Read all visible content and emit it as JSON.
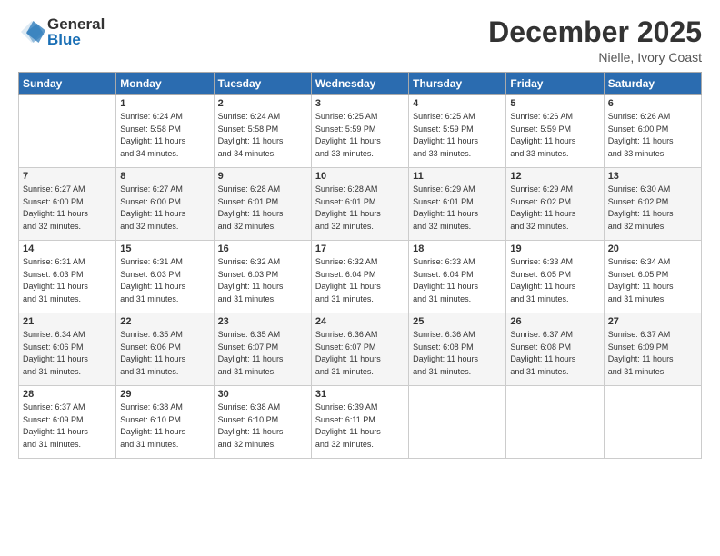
{
  "logo": {
    "general": "General",
    "blue": "Blue"
  },
  "title": "December 2025",
  "location": "Nielle, Ivory Coast",
  "headers": [
    "Sunday",
    "Monday",
    "Tuesday",
    "Wednesday",
    "Thursday",
    "Friday",
    "Saturday"
  ],
  "weeks": [
    [
      {
        "day": "",
        "info": ""
      },
      {
        "day": "1",
        "info": "Sunrise: 6:24 AM\nSunset: 5:58 PM\nDaylight: 11 hours\nand 34 minutes."
      },
      {
        "day": "2",
        "info": "Sunrise: 6:24 AM\nSunset: 5:58 PM\nDaylight: 11 hours\nand 34 minutes."
      },
      {
        "day": "3",
        "info": "Sunrise: 6:25 AM\nSunset: 5:59 PM\nDaylight: 11 hours\nand 33 minutes."
      },
      {
        "day": "4",
        "info": "Sunrise: 6:25 AM\nSunset: 5:59 PM\nDaylight: 11 hours\nand 33 minutes."
      },
      {
        "day": "5",
        "info": "Sunrise: 6:26 AM\nSunset: 5:59 PM\nDaylight: 11 hours\nand 33 minutes."
      },
      {
        "day": "6",
        "info": "Sunrise: 6:26 AM\nSunset: 6:00 PM\nDaylight: 11 hours\nand 33 minutes."
      }
    ],
    [
      {
        "day": "7",
        "info": "Sunrise: 6:27 AM\nSunset: 6:00 PM\nDaylight: 11 hours\nand 32 minutes."
      },
      {
        "day": "8",
        "info": "Sunrise: 6:27 AM\nSunset: 6:00 PM\nDaylight: 11 hours\nand 32 minutes."
      },
      {
        "day": "9",
        "info": "Sunrise: 6:28 AM\nSunset: 6:01 PM\nDaylight: 11 hours\nand 32 minutes."
      },
      {
        "day": "10",
        "info": "Sunrise: 6:28 AM\nSunset: 6:01 PM\nDaylight: 11 hours\nand 32 minutes."
      },
      {
        "day": "11",
        "info": "Sunrise: 6:29 AM\nSunset: 6:01 PM\nDaylight: 11 hours\nand 32 minutes."
      },
      {
        "day": "12",
        "info": "Sunrise: 6:29 AM\nSunset: 6:02 PM\nDaylight: 11 hours\nand 32 minutes."
      },
      {
        "day": "13",
        "info": "Sunrise: 6:30 AM\nSunset: 6:02 PM\nDaylight: 11 hours\nand 32 minutes."
      }
    ],
    [
      {
        "day": "14",
        "info": "Sunrise: 6:31 AM\nSunset: 6:03 PM\nDaylight: 11 hours\nand 31 minutes."
      },
      {
        "day": "15",
        "info": "Sunrise: 6:31 AM\nSunset: 6:03 PM\nDaylight: 11 hours\nand 31 minutes."
      },
      {
        "day": "16",
        "info": "Sunrise: 6:32 AM\nSunset: 6:03 PM\nDaylight: 11 hours\nand 31 minutes."
      },
      {
        "day": "17",
        "info": "Sunrise: 6:32 AM\nSunset: 6:04 PM\nDaylight: 11 hours\nand 31 minutes."
      },
      {
        "day": "18",
        "info": "Sunrise: 6:33 AM\nSunset: 6:04 PM\nDaylight: 11 hours\nand 31 minutes."
      },
      {
        "day": "19",
        "info": "Sunrise: 6:33 AM\nSunset: 6:05 PM\nDaylight: 11 hours\nand 31 minutes."
      },
      {
        "day": "20",
        "info": "Sunrise: 6:34 AM\nSunset: 6:05 PM\nDaylight: 11 hours\nand 31 minutes."
      }
    ],
    [
      {
        "day": "21",
        "info": "Sunrise: 6:34 AM\nSunset: 6:06 PM\nDaylight: 11 hours\nand 31 minutes."
      },
      {
        "day": "22",
        "info": "Sunrise: 6:35 AM\nSunset: 6:06 PM\nDaylight: 11 hours\nand 31 minutes."
      },
      {
        "day": "23",
        "info": "Sunrise: 6:35 AM\nSunset: 6:07 PM\nDaylight: 11 hours\nand 31 minutes."
      },
      {
        "day": "24",
        "info": "Sunrise: 6:36 AM\nSunset: 6:07 PM\nDaylight: 11 hours\nand 31 minutes."
      },
      {
        "day": "25",
        "info": "Sunrise: 6:36 AM\nSunset: 6:08 PM\nDaylight: 11 hours\nand 31 minutes."
      },
      {
        "day": "26",
        "info": "Sunrise: 6:37 AM\nSunset: 6:08 PM\nDaylight: 11 hours\nand 31 minutes."
      },
      {
        "day": "27",
        "info": "Sunrise: 6:37 AM\nSunset: 6:09 PM\nDaylight: 11 hours\nand 31 minutes."
      }
    ],
    [
      {
        "day": "28",
        "info": "Sunrise: 6:37 AM\nSunset: 6:09 PM\nDaylight: 11 hours\nand 31 minutes."
      },
      {
        "day": "29",
        "info": "Sunrise: 6:38 AM\nSunset: 6:10 PM\nDaylight: 11 hours\nand 31 minutes."
      },
      {
        "day": "30",
        "info": "Sunrise: 6:38 AM\nSunset: 6:10 PM\nDaylight: 11 hours\nand 32 minutes."
      },
      {
        "day": "31",
        "info": "Sunrise: 6:39 AM\nSunset: 6:11 PM\nDaylight: 11 hours\nand 32 minutes."
      },
      {
        "day": "",
        "info": ""
      },
      {
        "day": "",
        "info": ""
      },
      {
        "day": "",
        "info": ""
      }
    ]
  ]
}
